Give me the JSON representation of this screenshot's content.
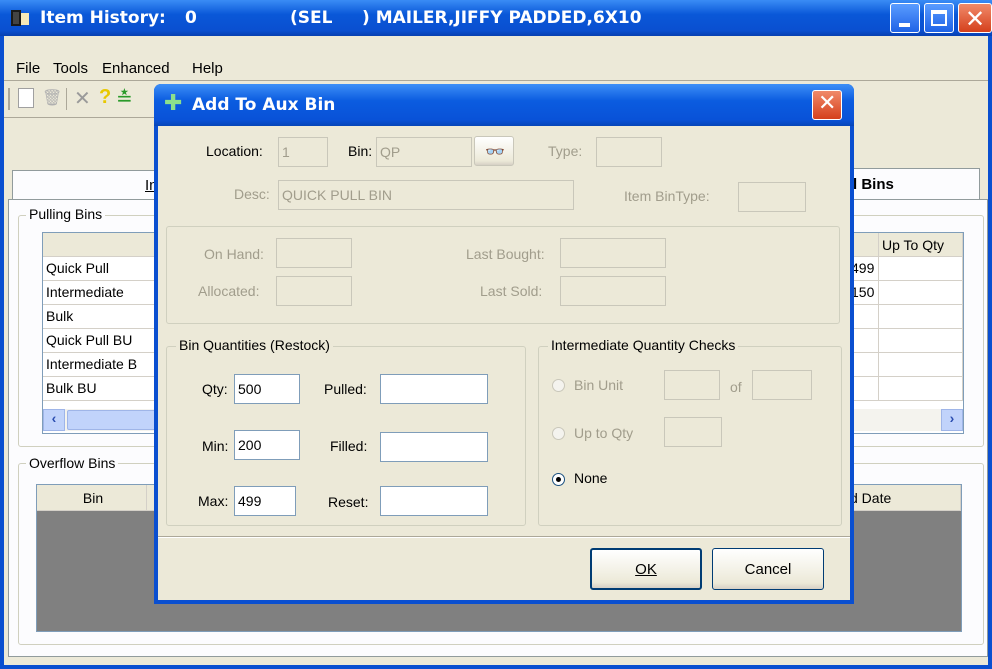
{
  "window": {
    "title_app": "Item History:",
    "title_id": "0",
    "title_sel": "(SEL",
    "title_item": ") MAILER,JIFFY PADDED,6X10"
  },
  "menu": [
    "File",
    "Tools",
    "Enhanced",
    "Help"
  ],
  "tabs": {
    "left_fragment": "In",
    "right_fragment": "l Bins"
  },
  "pulling_bins": {
    "label": "Pulling Bins",
    "rows": [
      "Quick Pull",
      "Intermediate",
      "Bulk",
      "Quick Pull BU",
      "Intermediate B",
      "Bulk BU"
    ],
    "right_header": "Up To Qty",
    "right_values": [
      "499",
      "150"
    ]
  },
  "overflow_bins": {
    "label": "Overflow Bins",
    "col_bin": "Bin",
    "col_date": "d Date"
  },
  "dialog": {
    "title": "Add To Aux Bin",
    "location_label": "Location:",
    "location_value": "1",
    "bin_label": "Bin:",
    "bin_value": "QP",
    "type_label": "Type:",
    "desc_label": "Desc:",
    "desc_value": "QUICK PULL BIN",
    "item_bin_type_label": "Item BinType:",
    "on_hand_label": "On Hand:",
    "allocated_label": "Allocated:",
    "last_bought_label": "Last Bought:",
    "last_sold_label": "Last Sold:",
    "restock": {
      "label": "Bin Quantities (Restock)",
      "qty_label": "Qty:",
      "qty_value": "500",
      "min_label": "Min:",
      "min_value": "200",
      "max_label": "Max:",
      "max_value": "499",
      "pulled_label": "Pulled:",
      "filled_label": "Filled:",
      "reset_label": "Reset:"
    },
    "checks": {
      "label": "Intermediate Quantity Checks",
      "bin_unit_label": "Bin Unit",
      "of_label": "of",
      "up_to_qty_label": "Up to Qty",
      "none_label": "None",
      "selected": "None"
    },
    "ok_label": "OK",
    "cancel_label": "Cancel"
  }
}
